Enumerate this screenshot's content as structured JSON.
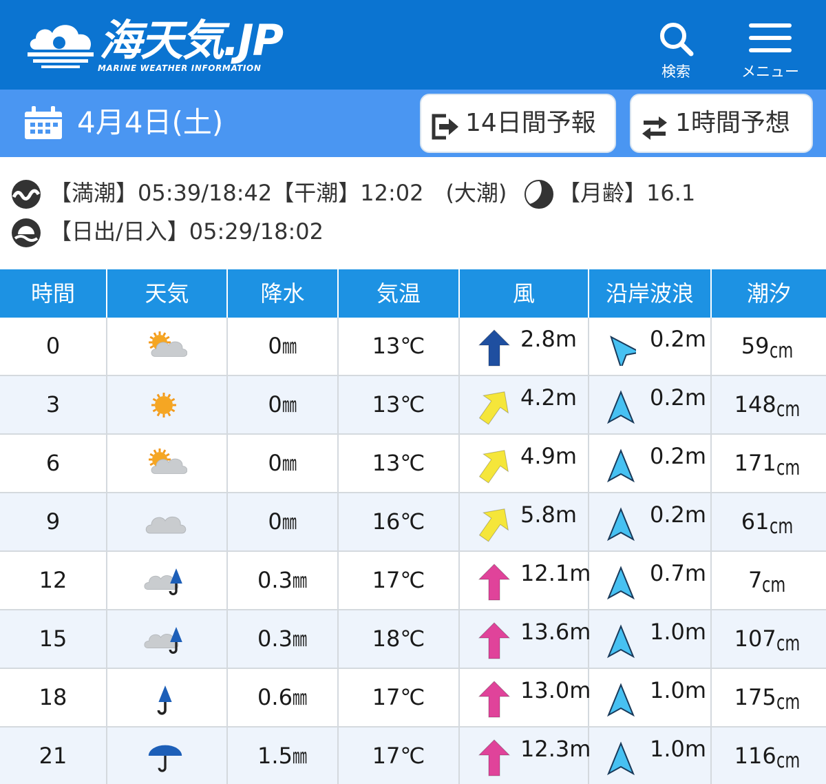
{
  "header": {
    "logo_text": "海天気.JP",
    "logo_subtitle": "MARINE WEATHER INFORMATION",
    "search_label": "検索",
    "menu_label": "メニュー",
    "background": "#0b74d1"
  },
  "datebar": {
    "date": "4月4日(土)",
    "btn_14day": "14日間予報",
    "btn_1hour": "1時間予想",
    "background": "#4a96f2"
  },
  "info": {
    "tide_text": "【満潮】05:39/18:42【干潮】12:02　(大潮)",
    "moon_text": "【月齢】16.1",
    "sun_text": "【日出/日入】05:29/18:02"
  },
  "table": {
    "headers": [
      "時間",
      "天気",
      "降水",
      "気温",
      "風",
      "沿岸波浪",
      "潮汐"
    ],
    "precip_unit": "㎜",
    "tide_unit": "cm",
    "rows": [
      {
        "time": "0",
        "weather": "sun-cloud-icon",
        "precip": "0",
        "temp": "13℃",
        "wind": "2.8m",
        "wind_dir": 0,
        "wind_color": "#1f4fa0",
        "wave": "0.2m",
        "wave_dir": -40,
        "tide": "59"
      },
      {
        "time": "3",
        "weather": "sun-icon",
        "precip": "0",
        "temp": "13℃",
        "wind": "4.2m",
        "wind_dir": 35,
        "wind_color": "#f5e63a",
        "wave": "0.2m",
        "wave_dir": 0,
        "tide": "148"
      },
      {
        "time": "6",
        "weather": "sun-cloud-icon",
        "precip": "0",
        "temp": "13℃",
        "wind": "4.9m",
        "wind_dir": 35,
        "wind_color": "#f5e63a",
        "wave": "0.2m",
        "wave_dir": 0,
        "tide": "171"
      },
      {
        "time": "9",
        "weather": "cloud-icon",
        "precip": "0",
        "temp": "16℃",
        "wind": "5.8m",
        "wind_dir": 35,
        "wind_color": "#f5e63a",
        "wave": "0.2m",
        "wave_dir": 0,
        "tide": "61"
      },
      {
        "time": "12",
        "weather": "cloud-rain-icon",
        "precip": "0.3",
        "temp": "17℃",
        "wind": "12.1m",
        "wind_dir": 0,
        "wind_color": "#e0439a",
        "wave": "0.7m",
        "wave_dir": 0,
        "tide": "7"
      },
      {
        "time": "15",
        "weather": "cloud-rain-icon",
        "precip": "0.3",
        "temp": "18℃",
        "wind": "13.6m",
        "wind_dir": 0,
        "wind_color": "#e0439a",
        "wave": "1.0m",
        "wave_dir": 0,
        "tide": "107"
      },
      {
        "time": "18",
        "weather": "closed-umbrella-icon",
        "precip": "0.6",
        "temp": "17℃",
        "wind": "13.0m",
        "wind_dir": 0,
        "wind_color": "#e0439a",
        "wave": "1.0m",
        "wave_dir": 0,
        "tide": "175"
      },
      {
        "time": "21",
        "weather": "umbrella-icon",
        "precip": "1.5",
        "temp": "17℃",
        "wind": "12.3m",
        "wind_dir": 0,
        "wind_color": "#e0439a",
        "wave": "1.0m",
        "wave_dir": 0,
        "tide": "116"
      }
    ]
  }
}
